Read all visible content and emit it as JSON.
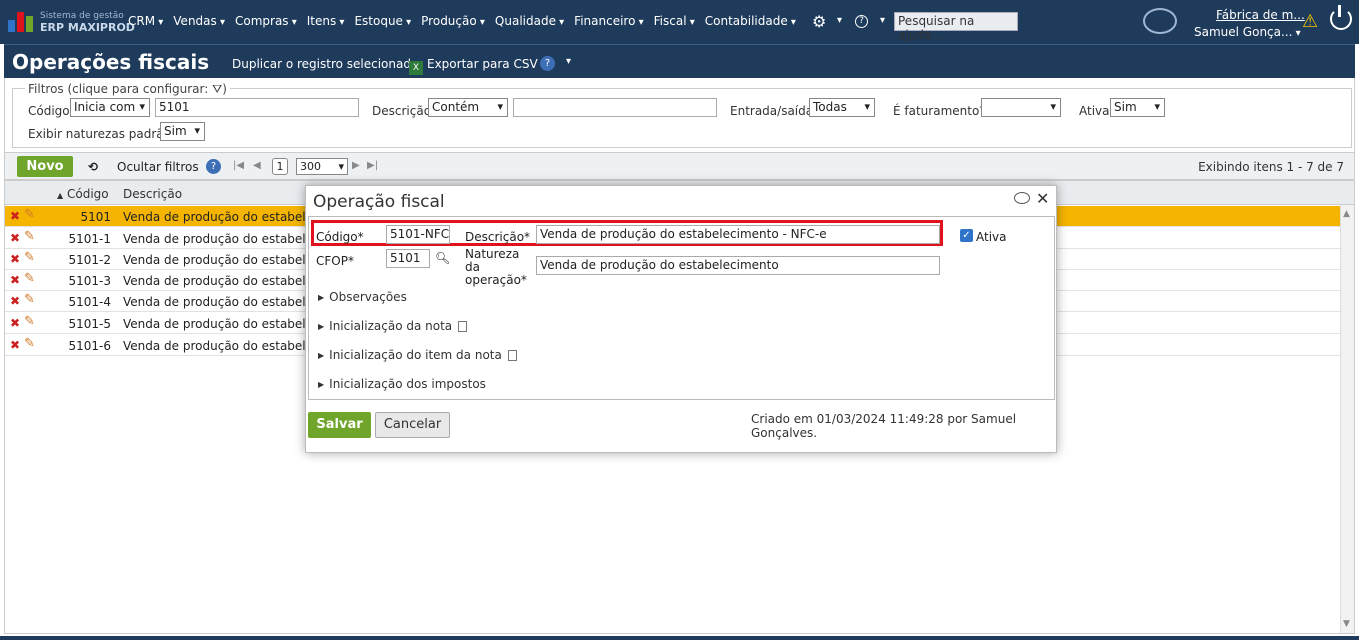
{
  "app": {
    "brand_small": "Sistema de gestão",
    "brand_big": "ERP MAXIPROD",
    "search_help_placeholder": "Pesquisar na ajuda...",
    "company": "Fábrica de m...",
    "user": "Samuel Gonça..."
  },
  "menu": [
    "CRM",
    "Vendas",
    "Compras",
    "Itens",
    "Estoque",
    "Produção",
    "Qualidade",
    "Financeiro",
    "Fiscal",
    "Contabilidade"
  ],
  "page": {
    "title": "Operações fiscais",
    "duplicate_label": "Duplicar o registro selecionado",
    "export_label": "Exportar para CSV"
  },
  "filters": {
    "legend": "Filtros (clique para configurar:",
    "legend_end": ")",
    "codigo_label": "Código",
    "codigo_op": "Inicia com",
    "codigo_value": "5101",
    "descricao_label": "Descrição",
    "descricao_op": "Contém",
    "descricao_value": "",
    "entrada_label": "Entrada/saída",
    "entrada_value": "Todas",
    "faturamento_label": "É faturamento?",
    "faturamento_value": "",
    "ativa_label": "Ativa",
    "ativa_value": "Sim",
    "naturezas_label": "Exibir naturezas padrão",
    "naturezas_value": "Sim"
  },
  "toolbar": {
    "novo": "Novo",
    "hide_filters": "Ocultar filtros",
    "page": "1",
    "page_size": "300",
    "info": "Exibindo itens 1 - 7 de 7"
  },
  "grid": {
    "col_codigo": "Código",
    "col_descricao": "Descrição",
    "rows": [
      {
        "codigo": "5101",
        "descricao": "Venda de produção do estabelecimento"
      },
      {
        "codigo": "5101-1",
        "descricao": "Venda de produção do estabelecimento"
      },
      {
        "codigo": "5101-2",
        "descricao": "Venda de produção do estabelecimento"
      },
      {
        "codigo": "5101-3",
        "descricao": "Venda de produção do estabelecimento"
      },
      {
        "codigo": "5101-4",
        "descricao": "Venda de produção do estabelecimento"
      },
      {
        "codigo": "5101-5",
        "descricao": "Venda de produção do estabelecimento"
      },
      {
        "codigo": "5101-6",
        "descricao": "Venda de produção do estabelecimento"
      }
    ]
  },
  "modal": {
    "title": "Operação fiscal",
    "codigo_label": "Código*",
    "codigo_value": "5101-NFC",
    "descricao_label": "Descrição*",
    "descricao_value": "Venda de produção do estabelecimento - NFC-e",
    "ativa_label": "Ativa",
    "cfop_label": "CFOP*",
    "cfop_value": "5101",
    "natureza_label_1": "Natureza",
    "natureza_label_2": "da",
    "natureza_label_3": "operação*",
    "natureza_value": "Venda de produção do estabelecimento",
    "sections": [
      "Observações",
      "Inicialização da nota",
      "Inicialização do item da nota",
      "Inicialização dos impostos"
    ],
    "save": "Salvar",
    "cancel": "Cancelar",
    "created": "Criado em 01/03/2024 11:49:28 por Samuel Gonçalves."
  }
}
